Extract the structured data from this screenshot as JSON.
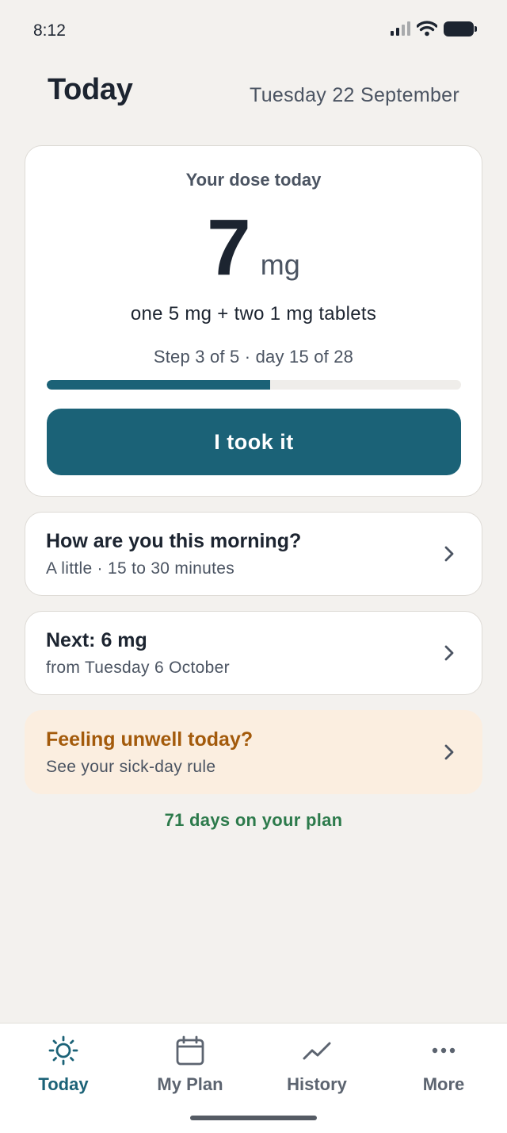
{
  "status_bar": {
    "time": "8:12",
    "icons": [
      "signal-icon",
      "wifi-icon",
      "battery-icon"
    ]
  },
  "header": {
    "title": "Today",
    "date": "Tuesday 22 September"
  },
  "dose_card": {
    "heading": "Your dose today",
    "dose_value": "7",
    "dose_unit": "mg",
    "tablet_detail": "one 5 mg + two 1 mg tablets",
    "step_text": "Step 3 of 5 · day 15 of 28",
    "progress_percent": 54,
    "button_label": "I took it"
  },
  "cards": {
    "morning": {
      "title": "How are you this morning?",
      "subtitle": "A little · 15 to 30 minutes"
    },
    "next_dose": {
      "title": "Next: 6 mg",
      "subtitle": "from Tuesday 6 October"
    },
    "unwell": {
      "title": "Feeling unwell today?",
      "subtitle": "See your sick-day rule"
    }
  },
  "plan_days": "71 days on your plan",
  "tab_bar": {
    "active": "Today",
    "tabs": [
      {
        "label": "Today",
        "icon": "sun-icon"
      },
      {
        "label": "My Plan",
        "icon": "calendar-icon"
      },
      {
        "label": "History",
        "icon": "trend-line-icon"
      },
      {
        "label": "More",
        "icon": "more-dots-icon"
      }
    ]
  },
  "colors": {
    "primary": "#1b6277",
    "background": "#f3f1ee",
    "warning_bg": "#fbeee0",
    "warning_text": "#a35a0b",
    "success_text": "#2c7a4b"
  }
}
